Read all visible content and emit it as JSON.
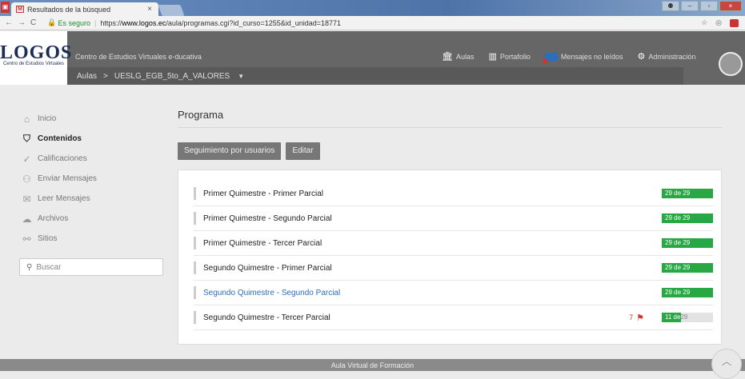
{
  "browser": {
    "tab_title": "Resultados de la búsqued",
    "secure_label": "Es seguro",
    "url_prefix": "https://",
    "url_domain": "www.logos.ec",
    "url_path": "/aula/programas.cgi?id_curso=1255&id_unidad=18771"
  },
  "header": {
    "logo_main": "LOGOS",
    "logo_sub": "Centro de Estudios Virtuales",
    "title": "Centro de Estudios Virtuales e-ducativa",
    "breadcrumb_root": "Aulas",
    "breadcrumb_sep": ">",
    "breadcrumb_current": "UESLG_EGB_5to_A_VALORES",
    "nav": {
      "aulas": "Aulas",
      "portafolio": "Portafolio",
      "mensajes": "Mensajes no leídos",
      "administracion": "Administración"
    }
  },
  "sidebar": {
    "items": [
      {
        "label": "Inicio",
        "icon": "home-icon"
      },
      {
        "label": "Contenidos",
        "icon": "graduation-cap-icon"
      },
      {
        "label": "Calificaciones",
        "icon": "check-circle-icon"
      },
      {
        "label": "Enviar Mensajes",
        "icon": "users-icon"
      },
      {
        "label": "Leer Mensajes",
        "icon": "envelope-icon"
      },
      {
        "label": "Archivos",
        "icon": "cloud-icon"
      },
      {
        "label": "Sitios",
        "icon": "link-icon"
      }
    ],
    "search_placeholder": "Buscar"
  },
  "main": {
    "title": "Programa",
    "btn_seguimiento": "Seguimiento por usuarios",
    "btn_editar": "Editar",
    "rows": [
      {
        "label": "Primer Quimestre - Primer Parcial",
        "done": "29",
        "total": "29",
        "progress_text": "29 de 29",
        "fraction": 1
      },
      {
        "label": "Primer Quimestre - Segundo Parcial",
        "done": "29",
        "total": "29",
        "progress_text": "29 de 29",
        "fraction": 1
      },
      {
        "label": "Primer Quimestre - Tercer Parcial",
        "done": "29",
        "total": "29",
        "progress_text": "29 de 29",
        "fraction": 1
      },
      {
        "label": "Segundo Quimestre - Primer Parcial",
        "done": "29",
        "total": "29",
        "progress_text": "29 de 29",
        "fraction": 1
      },
      {
        "label": "Segundo Quimestre - Segundo Parcial",
        "done": "29",
        "total": "29",
        "progress_text": "29 de 29",
        "fraction": 1
      },
      {
        "label": "Segundo Quimestre - Tercer Parcial",
        "done": "11",
        "total": "29",
        "progress_text_a": "11 de",
        "progress_text_b": "29",
        "fraction": 0.38,
        "flags": "7"
      }
    ]
  },
  "footer": {
    "text": "Aula Virtual de Formación"
  },
  "colors": {
    "progress_green": "#27a844",
    "flag_red": "#d9332b",
    "link_blue": "#2a6ebd"
  }
}
